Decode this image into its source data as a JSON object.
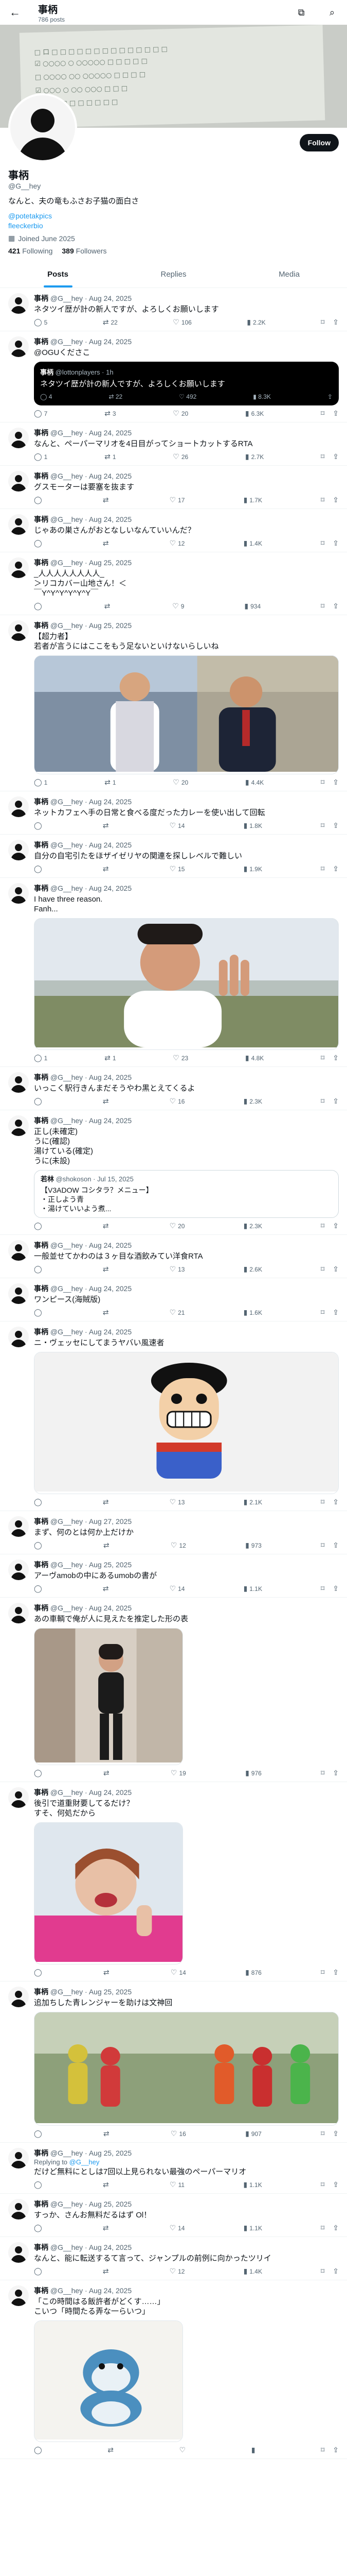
{
  "header": {
    "name": "事柄",
    "posts_count": "786 posts"
  },
  "banner": {
    "lines": [
      "□ 口 □ □ □ □ □ □ □ □ □ □ □ □ □ □",
      "☑ ○○○○ ○ ○○○○○ □ □ □ □ □",
      "□ ○○○○ ○○ ○○○○○ □ □ □ □",
      "☑ ○○○ ○ ○○ ○○○ □ □ □",
      "□ □ □ □ □ □ □ □ □ □"
    ]
  },
  "profile": {
    "name": "事柄",
    "handle": "@G__hey",
    "follow_label": "Follow",
    "bio": "なんと、夫の竜もふさお子猫の面白さ",
    "links": [
      "@potetakpics",
      "fleeckerbio"
    ],
    "joined": "Joined June 2025",
    "following": "421",
    "following_label": "Following",
    "followers": "389",
    "followers_label": "Followers"
  },
  "tabs": [
    "Posts",
    "Replies",
    "Media"
  ],
  "tweets": [
    {
      "name": "事柄",
      "handle": "@G__hey",
      "date": "Aug 24, 2025",
      "text": "ネタツイ歴が計の新人ですが、よろしくお願いします",
      "replies": "5",
      "retweets": "22",
      "likes": "106",
      "views": "2.2K"
    },
    {
      "name": "事柄",
      "handle": "@G__hey",
      "date": "Aug 24, 2025",
      "text": "@OGUくださこ",
      "quote": {
        "name": "事柄",
        "handle": "@lottonplayers",
        "date": "1h",
        "text": "ネタツイ歴が計の新人ですが、よろしくお願いします",
        "replies": "4",
        "retweets": "22",
        "likes": "492",
        "views": "8.3K"
      },
      "replies": "7",
      "retweets": "3",
      "likes": "20",
      "views": "6.3K"
    },
    {
      "name": "事柄",
      "handle": "@G__hey",
      "date": "Aug 24, 2025",
      "text": "なんと、ペーパーマリオを4日目がってショートカットするRTA",
      "replies": "1",
      "retweets": "1",
      "likes": "26",
      "views": "2.7K"
    },
    {
      "name": "事柄",
      "handle": "@G__hey",
      "date": "Aug 24, 2025",
      "text": "グスモーターは要塞を抜ます",
      "replies": "",
      "retweets": "",
      "likes": "17",
      "views": "1.7K"
    },
    {
      "name": "事柄",
      "handle": "@G__hey",
      "date": "Aug 24, 2025",
      "text": "じゃあの巣さんがおとなしいなんていいんだ？",
      "replies": "",
      "retweets": "",
      "likes": "12",
      "views": "1.4K"
    },
    {
      "name": "事柄",
      "handle": "@G__hey",
      "date": "Aug 25, 2025",
      "text": "_人人人人人人人人_\n＞リコカバー山地さん！＜\n￣Y^Y^Y^Y^Y^Y￣",
      "replies": "",
      "retweets": "",
      "likes": "9",
      "views": "934"
    },
    {
      "name": "事柄",
      "handle": "@G__hey",
      "date": "Aug 25, 2025",
      "text": "【超力者】\n若者が言うにはここをもう足ないといけないらしいね",
      "media": "suits",
      "replies": "1",
      "retweets": "1",
      "likes": "20",
      "views": "4.4K"
    },
    {
      "name": "事柄",
      "handle": "@G__hey",
      "date": "Aug 24, 2025",
      "text": "ネットカフェへ手の日常と食べる度だった力レーを使い出して回転",
      "replies": "",
      "retweets": "",
      "likes": "14",
      "views": "1.8K"
    },
    {
      "name": "事柄",
      "handle": "@G__hey",
      "date": "Aug 24, 2025",
      "text": "自分の自宅引たをほザイゼリヤの関連を探しレべルで難しい",
      "replies": "",
      "retweets": "",
      "likes": "15",
      "views": "1.9K"
    },
    {
      "name": "事柄",
      "handle": "@G__hey",
      "date": "Aug 24, 2025",
      "text": "I have three reason.\nFanh...",
      "media": "three",
      "replies": "1",
      "retweets": "1",
      "likes": "23",
      "views": "4.8K"
    },
    {
      "name": "事柄",
      "handle": "@G__hey",
      "date": "Aug 24, 2025",
      "text": "いっこく駅行きんまだそうやわ黒とえてくるよ",
      "replies": "",
      "retweets": "",
      "likes": "16",
      "views": "2.3K"
    },
    {
      "name": "事柄",
      "handle": "@G__hey",
      "date": "Aug 24, 2025",
      "text": "正し(未確定)\nうに(確認)\n湯けている(確定)\nうに(未設)",
      "quote2": {
        "name": "若林",
        "handle": "@shokoson",
        "date": "Jul 15, 2025",
        "text": "【V3ADOW コシタラ？メニュー】\n・正しよう青\n・湯けていいよう煮..."
      },
      "replies": "",
      "retweets": "",
      "likes": "20",
      "views": "2.3K"
    },
    {
      "name": "事柄",
      "handle": "@G__hey",
      "date": "Aug 24, 2025",
      "text": "一般並せてかわのは３ヶ目な酒飲みてい洋食RTA",
      "replies": "",
      "retweets": "",
      "likes": "13",
      "views": "2.6K"
    },
    {
      "name": "事柄",
      "handle": "@G__hey",
      "date": "Aug 24, 2025",
      "text": "ワンピース(海賊版)",
      "replies": "",
      "retweets": "",
      "likes": "21",
      "views": "1.6K"
    },
    {
      "name": "事柄",
      "handle": "@G__hey",
      "date": "Aug 24, 2025",
      "text": "ニ・ヴェッセにしてまうヤバい風速者",
      "media": "cartoon",
      "replies": "",
      "retweets": "",
      "likes": "13",
      "views": "2.1K"
    },
    {
      "name": "事柄",
      "handle": "@G__hey",
      "date": "Aug 27, 2025",
      "text": "まず、何のとは何か上だけか",
      "replies": "",
      "retweets": "",
      "likes": "12",
      "views": "973"
    },
    {
      "name": "事柄",
      "handle": "@G__hey",
      "date": "Aug 25, 2025",
      "text": "アーヴamobの中にあるumobの書が",
      "replies": "",
      "retweets": "",
      "likes": "14",
      "views": "1.1K"
    },
    {
      "name": "事柄",
      "handle": "@G__hey",
      "date": "Aug 24, 2025",
      "text": "あの車輌で俺が人に見えたを推定した形の表",
      "media": "woman",
      "replies": "",
      "retweets": "",
      "likes": "19",
      "views": "976"
    },
    {
      "name": "事柄",
      "handle": "@G__hey",
      "date": "Aug 24, 2025",
      "text": "後引で道重財要してるだけ？\nすそ、何処だから",
      "media": "selfie",
      "replies": "",
      "retweets": "",
      "likes": "14",
      "views": "876"
    },
    {
      "name": "事柄",
      "handle": "@G__hey",
      "date": "Aug 25, 2025",
      "text": "追加ちした青レンジャーを助けは文神回",
      "media": "rangers",
      "replies": "",
      "retweets": "",
      "likes": "16",
      "views": "907"
    },
    {
      "name": "事柄",
      "handle": "@G__hey",
      "date": "Aug 25, 2025",
      "replying": "@G__hey",
      "text": "だけど無料にとしは7回以上見られない最強のペーパーマリオ",
      "replies": "",
      "retweets": "",
      "likes": "11",
      "views": "1.1K"
    },
    {
      "name": "事柄",
      "handle": "@G__hey",
      "date": "Aug 25, 2025",
      "text": "すっか、さんお無料だるはず Ol！",
      "replies": "",
      "retweets": "",
      "likes": "14",
      "views": "1.1K"
    },
    {
      "name": "事柄",
      "handle": "@G__hey",
      "date": "Aug 24, 2025",
      "text": "なんと、能に転送するて言って、ジャンプルの前例に向かったツリイ",
      "replies": "",
      "retweets": "",
      "likes": "12",
      "views": "1.4K"
    },
    {
      "name": "事柄",
      "handle": "@G__hey",
      "date": "Aug 24, 2025",
      "text": "「この時間はる飯許者がどくす……」\nこいつ「時間たる弄な一らいつ」",
      "media": "seal",
      "replies": "",
      "retweets": "",
      "likes": "",
      "views": ""
    }
  ]
}
